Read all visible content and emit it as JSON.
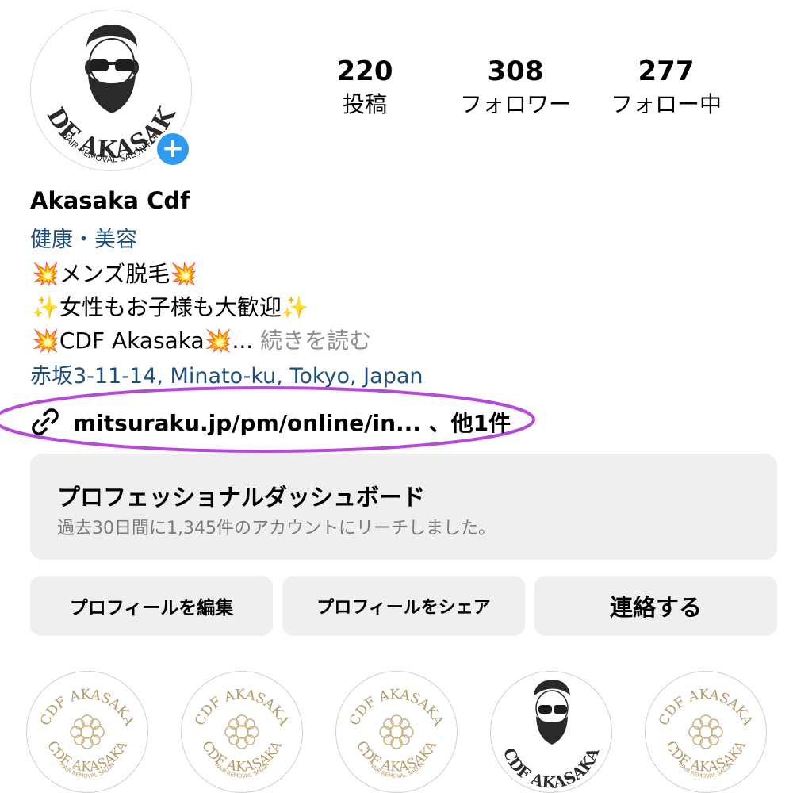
{
  "profile": {
    "name": "Akasaka Cdf",
    "category": "健康・美容",
    "bio": {
      "line1": "💥メンズ脱毛💥",
      "line2": "✨女性もお子様も大歓迎✨",
      "line3": "💥CDF Akasaka💥...",
      "more": " 続きを読む"
    },
    "address": "赤坂3-11-14, Minato-ku, Tokyo, Japan",
    "link": "mitsuraku.jp/pm/online/in... 、他1件",
    "avatar_text": "CDF AKASAKA",
    "avatar_subtext": "HAIR REMOVAL SALON FOR"
  },
  "stats": {
    "posts": {
      "value": "220",
      "label": "投稿"
    },
    "followers": {
      "value": "308",
      "label": "フォロワー"
    },
    "following": {
      "value": "277",
      "label": "フォロー中"
    }
  },
  "dashboard": {
    "title": "プロフェッショナルダッシュボード",
    "subtitle": "過去30日間に1,345件のアカウントにリーチしました。"
  },
  "buttons": {
    "edit": "プロフィールを編集",
    "share": "プロフィールをシェア",
    "contact": "連絡する"
  },
  "highlights": {
    "text_top": "CDF AKASAKA",
    "text_bottom": "CDF AKASAKA",
    "text_small": "HAIR REMOVAL SALON"
  },
  "colors": {
    "accent_blue": "#2f9bf0",
    "link_blue": "#1f4e79",
    "highlight_ring": "#b44bd8",
    "button_bg": "#efefef"
  },
  "icons": [
    "plus-icon",
    "link-icon",
    "mandala-logo"
  ]
}
